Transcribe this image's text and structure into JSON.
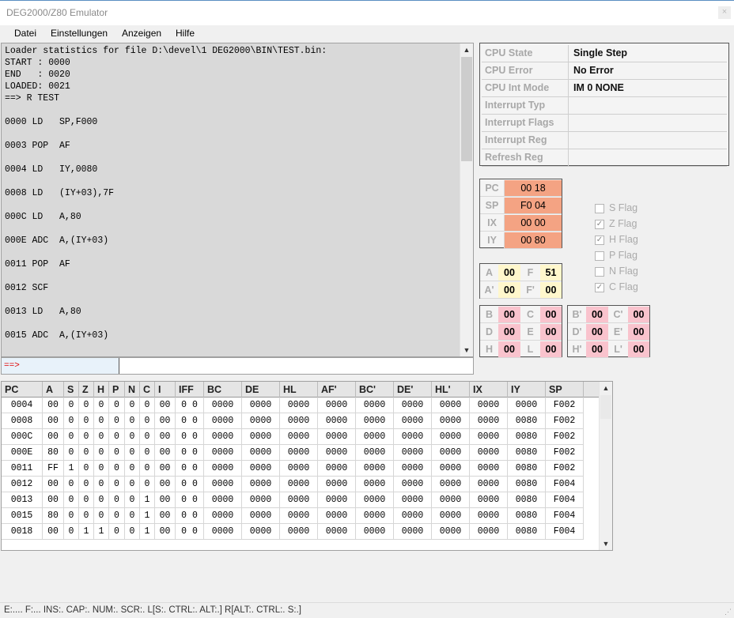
{
  "window": {
    "title": "DEG2000/Z80 Emulator",
    "close": "×"
  },
  "menu": [
    "Datei",
    "Einstellungen",
    "Anzeigen",
    "Hilfe"
  ],
  "console": {
    "lines": [
      "Loader statistics for file D:\\devel\\1 DEG2000\\BIN\\TEST.bin:",
      "START : 0000",
      "END   : 0020",
      "LOADED: 0021",
      "==> R TEST",
      "",
      "0000 LD   SP,F000",
      "",
      "0003 POP  AF",
      "",
      "0004 LD   IY,0080",
      "",
      "0008 LD   (IY+03),7F",
      "",
      "000C LD   A,80",
      "",
      "000E ADC  A,(IY+03)",
      "",
      "0011 POP  AF",
      "",
      "0012 SCF",
      "",
      "0013 LD   A,80",
      "",
      "0015 ADC  A,(IY+03)"
    ],
    "prompt": "==>"
  },
  "cpu_state": [
    {
      "label": "CPU State",
      "value": "Single Step"
    },
    {
      "label": "CPU Error",
      "value": "No Error"
    },
    {
      "label": "CPU Int Mode",
      "value": "IM 0   NONE"
    },
    {
      "label": "Interrupt Typ",
      "value": ""
    },
    {
      "label": "Interrupt Flags",
      "value": ""
    },
    {
      "label": "Interrupt Reg",
      "value": ""
    },
    {
      "label": "Refresh   Reg",
      "value": ""
    }
  ],
  "pointer_regs": [
    {
      "name": "PC",
      "value": "00 18"
    },
    {
      "name": "SP",
      "value": "F0 04"
    },
    {
      "name": "IX",
      "value": "00 00"
    },
    {
      "name": "IY",
      "value": "00 80"
    }
  ],
  "af_regs": [
    {
      "n1": "A",
      "v1": "00",
      "n2": "F",
      "v2": "51"
    },
    {
      "n1": "A'",
      "v1": "00",
      "n2": "F'",
      "v2": "00"
    }
  ],
  "main_regs": [
    {
      "n1": "B",
      "v1": "00",
      "n2": "C",
      "v2": "00"
    },
    {
      "n1": "D",
      "v1": "00",
      "n2": "E",
      "v2": "00"
    },
    {
      "n1": "H",
      "v1": "00",
      "n2": "L",
      "v2": "00"
    }
  ],
  "alt_regs": [
    {
      "n1": "B'",
      "v1": "00",
      "n2": "C'",
      "v2": "00"
    },
    {
      "n1": "D'",
      "v1": "00",
      "n2": "E'",
      "v2": "00"
    },
    {
      "n1": "H'",
      "v1": "00",
      "n2": "L'",
      "v2": "00"
    }
  ],
  "flags": [
    {
      "label": "S Flag",
      "checked": false
    },
    {
      "label": "Z Flag",
      "checked": true
    },
    {
      "label": "H Flag",
      "checked": true
    },
    {
      "label": "P Flag",
      "checked": false
    },
    {
      "label": "N Flag",
      "checked": false
    },
    {
      "label": "C Flag",
      "checked": true
    }
  ],
  "colors": {
    "pointer_bg": "#f4a383",
    "af_bg": "#fff7cc",
    "reg_bg": "#f9c3cd",
    "prompt_text": "#e00000"
  },
  "trace": {
    "columns": [
      "PC",
      "A",
      "S",
      "Z",
      "H",
      "P",
      "N",
      "C",
      "I",
      "IFF",
      "BC",
      "DE",
      "HL",
      "AF'",
      "BC'",
      "DE'",
      "HL'",
      "IX",
      "IY",
      "SP"
    ],
    "rows": [
      [
        "0004",
        "00",
        "0",
        "0",
        "0",
        "0",
        "0",
        "0",
        "00",
        "0 0",
        "0000",
        "0000",
        "0000",
        "0000",
        "0000",
        "0000",
        "0000",
        "0000",
        "0000",
        "F002"
      ],
      [
        "0008",
        "00",
        "0",
        "0",
        "0",
        "0",
        "0",
        "0",
        "00",
        "0 0",
        "0000",
        "0000",
        "0000",
        "0000",
        "0000",
        "0000",
        "0000",
        "0000",
        "0080",
        "F002"
      ],
      [
        "000C",
        "00",
        "0",
        "0",
        "0",
        "0",
        "0",
        "0",
        "00",
        "0 0",
        "0000",
        "0000",
        "0000",
        "0000",
        "0000",
        "0000",
        "0000",
        "0000",
        "0080",
        "F002"
      ],
      [
        "000E",
        "80",
        "0",
        "0",
        "0",
        "0",
        "0",
        "0",
        "00",
        "0 0",
        "0000",
        "0000",
        "0000",
        "0000",
        "0000",
        "0000",
        "0000",
        "0000",
        "0080",
        "F002"
      ],
      [
        "0011",
        "FF",
        "1",
        "0",
        "0",
        "0",
        "0",
        "0",
        "00",
        "0 0",
        "0000",
        "0000",
        "0000",
        "0000",
        "0000",
        "0000",
        "0000",
        "0000",
        "0080",
        "F002"
      ],
      [
        "0012",
        "00",
        "0",
        "0",
        "0",
        "0",
        "0",
        "0",
        "00",
        "0 0",
        "0000",
        "0000",
        "0000",
        "0000",
        "0000",
        "0000",
        "0000",
        "0000",
        "0080",
        "F004"
      ],
      [
        "0013",
        "00",
        "0",
        "0",
        "0",
        "0",
        "0",
        "1",
        "00",
        "0 0",
        "0000",
        "0000",
        "0000",
        "0000",
        "0000",
        "0000",
        "0000",
        "0000",
        "0080",
        "F004"
      ],
      [
        "0015",
        "80",
        "0",
        "0",
        "0",
        "0",
        "0",
        "1",
        "00",
        "0 0",
        "0000",
        "0000",
        "0000",
        "0000",
        "0000",
        "0000",
        "0000",
        "0000",
        "0080",
        "F004"
      ],
      [
        "0018",
        "00",
        "0",
        "1",
        "1",
        "0",
        "0",
        "1",
        "00",
        "0 0",
        "0000",
        "0000",
        "0000",
        "0000",
        "0000",
        "0000",
        "0000",
        "0000",
        "0080",
        "F004"
      ]
    ]
  },
  "status": "E:....  F:...  INS:. CAP:. NUM:. SCR:.  L[S:. CTRL:. ALT:.]  R[ALT:. CTRL:. S:.]"
}
